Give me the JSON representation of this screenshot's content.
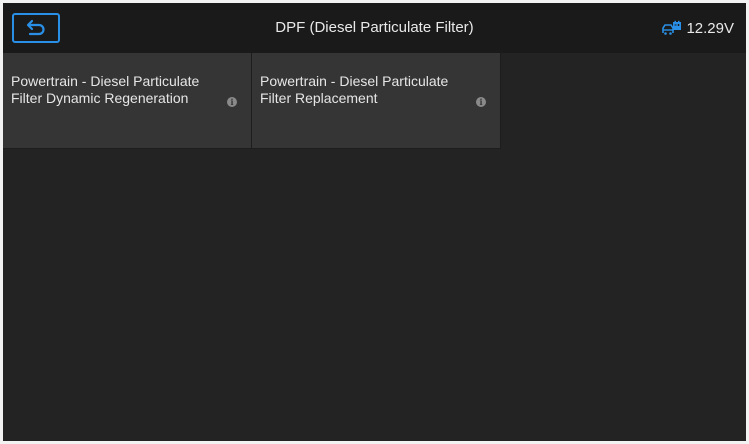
{
  "header": {
    "title": "DPF (Diesel Particulate Filter)",
    "voltage": "12.29V",
    "back_icon": "back-arrow-icon",
    "vehicle_icon": "vehicle-battery-icon"
  },
  "tiles": [
    {
      "label": "Powertrain - Diesel Particulate Filter Dynamic Regeneration",
      "icon": "info-icon"
    },
    {
      "label": "Powertrain - Diesel Particulate Filter Replacement",
      "icon": "info-icon"
    }
  ],
  "colors": {
    "accent": "#2a8fe6",
    "background": "#232323",
    "tile": "#353535"
  }
}
